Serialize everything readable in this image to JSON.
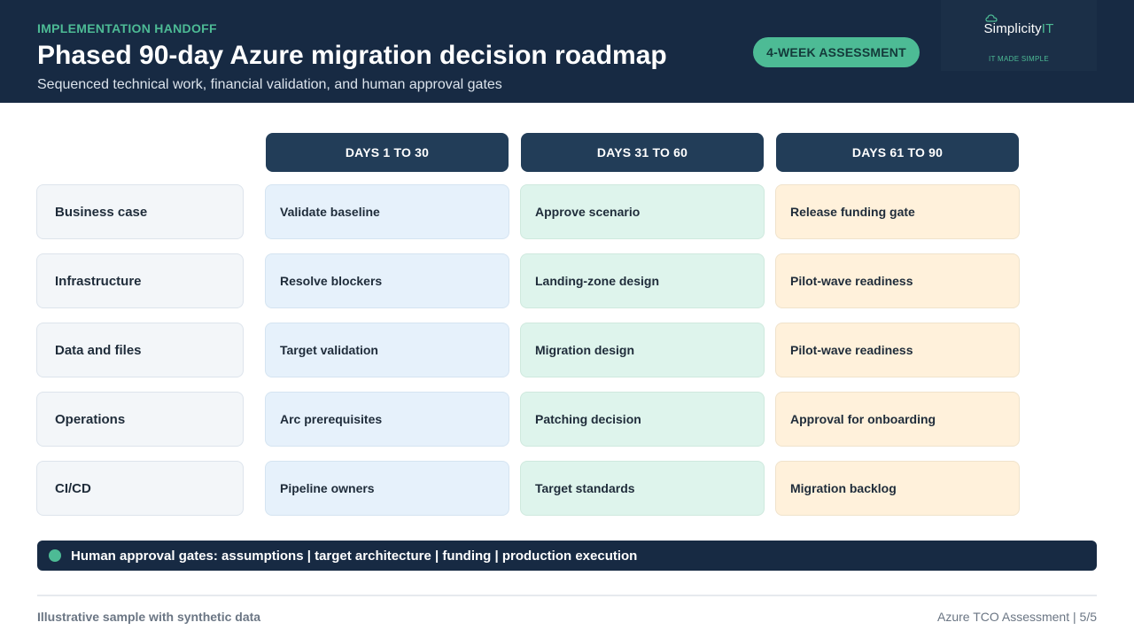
{
  "header": {
    "eyebrow": "IMPLEMENTATION HANDOFF",
    "title": "Phased 90-day Azure migration decision roadmap",
    "subtitle": "Sequenced technical work, financial validation, and human approval gates",
    "badge": "4-WEEK ASSESSMENT"
  },
  "logo": {
    "word_main": "Simplicity",
    "word_accent": "IT",
    "tagline": "IT MADE SIMPLE",
    "icon": "cloud-logo-icon"
  },
  "columns": [
    "DAYS 1 TO 30",
    "DAYS 31 TO 60",
    "DAYS 61 TO 90"
  ],
  "rows": [
    {
      "label": "Business case",
      "cells": [
        "Validate baseline",
        "Approve scenario",
        "Release funding gate"
      ]
    },
    {
      "label": "Infrastructure",
      "cells": [
        "Resolve blockers",
        "Landing-zone design",
        "Pilot-wave readiness"
      ]
    },
    {
      "label": "Data and files",
      "cells": [
        "Target validation",
        "Migration design",
        "Pilot-wave readiness"
      ]
    },
    {
      "label": "Operations",
      "cells": [
        "Arc prerequisites",
        "Patching decision",
        "Approval for onboarding"
      ]
    },
    {
      "label": "CI/CD",
      "cells": [
        "Pipeline owners",
        "Target standards",
        "Migration backlog"
      ]
    }
  ],
  "gate_bar": {
    "text": "Human approval gates: assumptions | target architecture | funding | production execution"
  },
  "footer": {
    "left": "Illustrative sample with synthetic data",
    "right": "Azure TCO Assessment | 5/5"
  },
  "colors": {
    "navy": "#172a43",
    "accent_green": "#4dbb95",
    "phase1": "#e6f1fb",
    "phase2": "#def4ec",
    "phase3": "#fff1db"
  }
}
